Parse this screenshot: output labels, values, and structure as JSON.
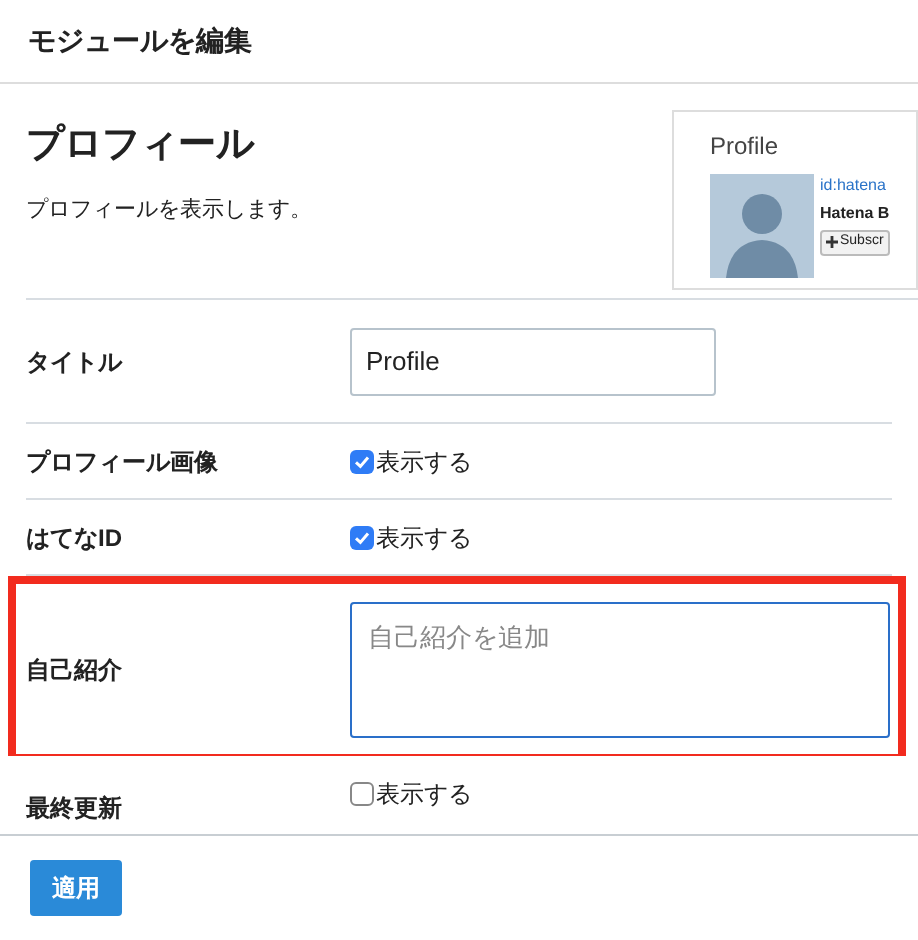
{
  "dialog": {
    "title": "モジュールを編集"
  },
  "module": {
    "name": "プロフィール",
    "description": "プロフィールを表示します。"
  },
  "preview": {
    "heading": "Profile",
    "user_id": "id:hatena",
    "user_name": "Hatena B",
    "subscribe_button": "Subscr"
  },
  "fields": [
    {
      "kind": "text",
      "label": "タイトル",
      "value": "Profile",
      "highlighted": false
    },
    {
      "kind": "checkbox",
      "label": "プロフィール画像",
      "option": "表示する",
      "checked": true,
      "highlighted": false
    },
    {
      "kind": "checkbox",
      "label": "はてなID",
      "option": "表示する",
      "checked": true,
      "highlighted": false
    },
    {
      "kind": "textarea",
      "label": "自己紹介",
      "placeholder": "自己紹介を追加",
      "highlighted": true
    },
    {
      "kind": "checkbox",
      "label": "最終更新",
      "option": "表示する",
      "checked": false,
      "highlighted": false
    }
  ],
  "footer": {
    "apply_button": "適用"
  }
}
